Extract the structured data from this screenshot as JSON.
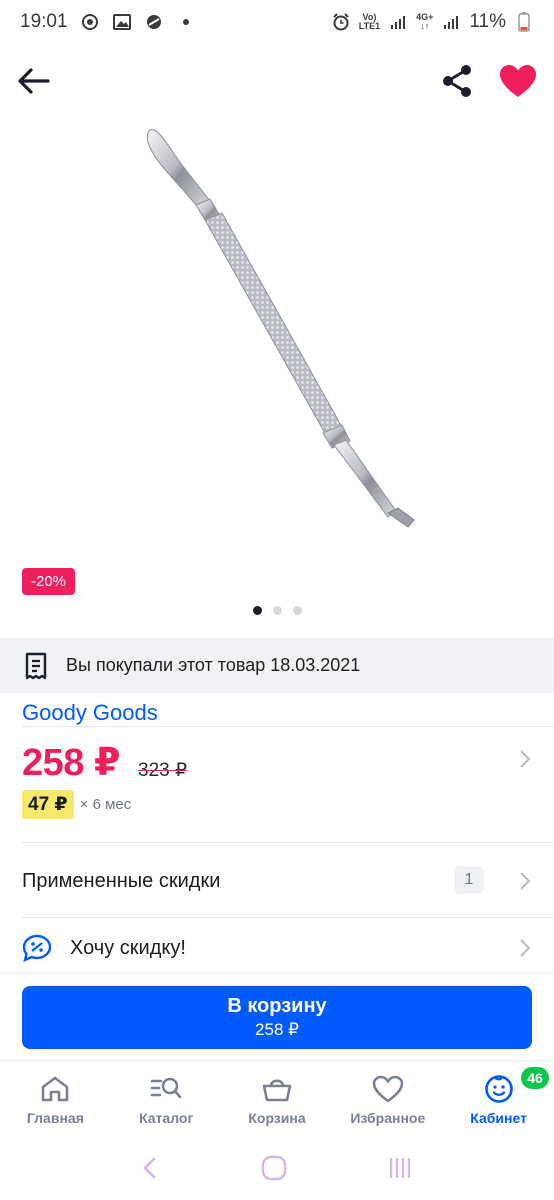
{
  "status_bar": {
    "time": "19:01",
    "network_top": "Vo)",
    "network_bottom": "LTE1",
    "lte_top": "4G+",
    "battery": "11%"
  },
  "header": {
    "back_icon": "arrow-left-icon",
    "share_icon": "share-icon",
    "favorite_icon": "heart-icon"
  },
  "product": {
    "image_description": "cuticle pusher",
    "discount": "-20%",
    "gallery_dots": 3,
    "gallery_active": 0,
    "purchase_notice": "Вы покупали этот товар 18.03.2021",
    "brand": "Goody Goods",
    "price": "258 ₽",
    "old_price": "323 ₽",
    "installment_amount": "47 ₽",
    "installment_term": "× 6 мес"
  },
  "rows": {
    "applied_discounts": "Примененные скидки",
    "applied_discounts_count": "1",
    "want_discount": "Хочу скидку!"
  },
  "cart_button": {
    "label": "В корзину",
    "price": "258 ₽"
  },
  "tabs": [
    {
      "label": "Главная",
      "icon": "home-icon"
    },
    {
      "label": "Каталог",
      "icon": "catalog-search-icon"
    },
    {
      "label": "Корзина",
      "icon": "basket-icon"
    },
    {
      "label": "Избранное",
      "icon": "heart-outline-icon"
    },
    {
      "label": "Кабинет",
      "icon": "face-icon",
      "badge": "46"
    }
  ],
  "colors": {
    "accent": "#005bff",
    "sale": "#ee1f5c",
    "installment": "#f6e86a",
    "badge_green": "#10c44c"
  }
}
